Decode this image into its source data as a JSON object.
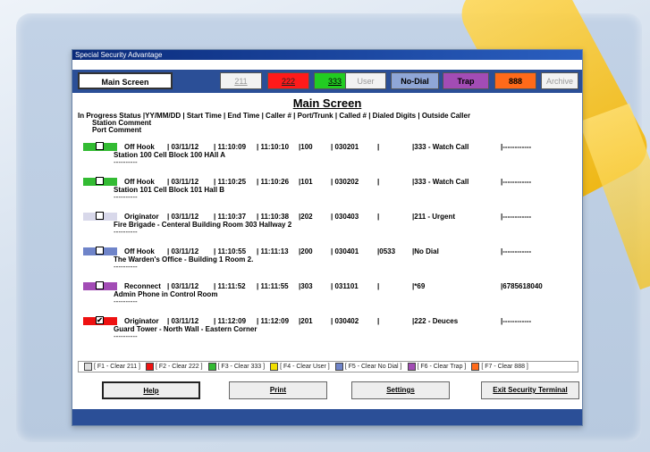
{
  "window": {
    "title": "Special Security Advantage"
  },
  "tabs": {
    "main": "Main Screen",
    "t211": "211",
    "t222": "222",
    "t333": "333",
    "user": "User",
    "nodial": "No-Dial",
    "trap": "Trap",
    "t888": "888",
    "archive": "Archive"
  },
  "screen_title": "Main Screen",
  "columns": {
    "row1": "In Progress  Status        |YY/MM/DD  | Start Time | End Time | Caller # | Port/Trunk | Called # | Dialed Digits                       | Outside Caller",
    "row2": "Station Comment",
    "row3": "Port Comment"
  },
  "calls": [
    {
      "color": "#33bb33",
      "checked": "",
      "status": "Off Hook",
      "date": "03/11/12",
      "start": "11:10:09",
      "end": "11:10:10",
      "caller": "100",
      "port": "030201",
      "called": "",
      "dialed": "333 - Watch Call",
      "outside": "------------",
      "station_comment": "Station 100 Cell Block 100 HAll A",
      "port_comment": "----------"
    },
    {
      "color": "#33bb33",
      "checked": "",
      "status": "Off Hook",
      "date": "03/11/12",
      "start": "11:10:25",
      "end": "11:10:26",
      "caller": "101",
      "port": "030202",
      "called": "",
      "dialed": "333 - Watch Call",
      "outside": "------------",
      "station_comment": "Station 101 Cell Block 101 Hall B",
      "port_comment": "----------"
    },
    {
      "color": "#d8d8ea",
      "checked": "",
      "status": "Originator",
      "date": "03/11/12",
      "start": "11:10:37",
      "end": "11:10:38",
      "caller": "202",
      "port": "030403",
      "called": "",
      "dialed": "211 - Urgent",
      "outside": "------------",
      "station_comment": "Fire Brigade - Centeral Building Room 303 Hallway 2",
      "port_comment": "----------"
    },
    {
      "color": "#6f84c9",
      "checked": "",
      "status": "Off Hook",
      "date": "03/11/12",
      "start": "11:10:55",
      "end": "11:11:13",
      "caller": "200",
      "port": "030401",
      "called": "0533",
      "dialed": "No Dial",
      "outside": "------------",
      "station_comment": "The Warden's Office - Building 1 Room 2.",
      "port_comment": "----------"
    },
    {
      "color": "#a24cb5",
      "checked": "",
      "status": "Reconnect",
      "date": "03/11/12",
      "start": "11:11:52",
      "end": "11:11:55",
      "caller": "303",
      "port": "031101",
      "called": "",
      "dialed": "*69",
      "outside": "6785618040",
      "station_comment": "Admin Phone in Control Room",
      "port_comment": "----------"
    },
    {
      "color": "#ee1111",
      "checked": "✔",
      "status": "Originator",
      "date": "03/11/12",
      "start": "11:12:09",
      "end": "11:12:09",
      "caller": "201",
      "port": "030402",
      "called": "",
      "dialed": "222 - Deuces",
      "outside": "------------",
      "station_comment": "Guard Tower - North Wall - Eastern Corner",
      "port_comment": "----------"
    }
  ],
  "legend": [
    {
      "color": "#dddddd",
      "label": "[ F1 - Clear 211 ]"
    },
    {
      "color": "#ee1111",
      "label": "[ F2 - Clear 222 ]"
    },
    {
      "color": "#33bb33",
      "label": "[ F3 - Clear 333 ]"
    },
    {
      "color": "#f2e000",
      "label": "[ F4 - Clear User ]"
    },
    {
      "color": "#6f84c9",
      "label": "[ F5 - Clear No Dial ]"
    },
    {
      "color": "#a24cb5",
      "label": "[ F6 - Clear Trap ]"
    },
    {
      "color": "#ff6a1a",
      "label": "[ F7 - Clear 888 ]"
    }
  ],
  "buttons": {
    "help": "Help",
    "print": "Print",
    "settings": "Settings",
    "exit": "Exit Security Terminal"
  }
}
